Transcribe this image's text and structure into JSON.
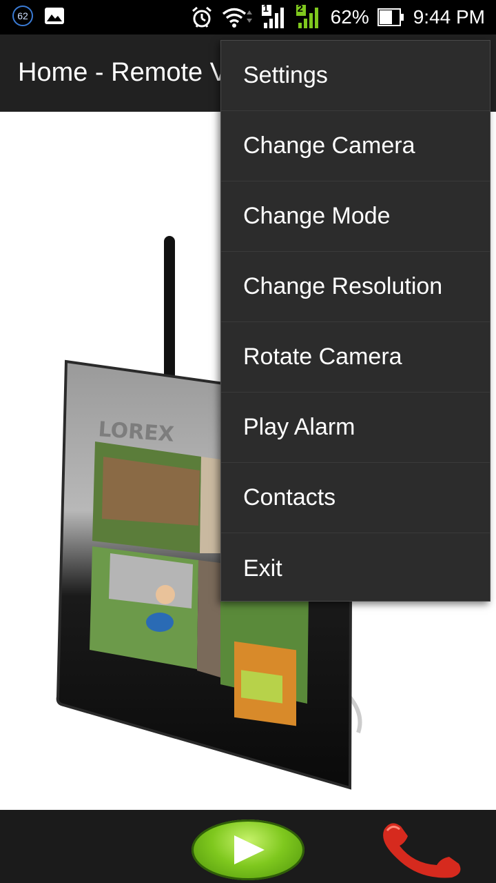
{
  "status_bar": {
    "notification_count": "62",
    "battery_percent": "62%",
    "time": "9:44 PM",
    "sim1_label": "1",
    "sim2_label": "2",
    "icons": [
      "notification-count-badge",
      "image-icon",
      "alarm-icon",
      "wifi-icon",
      "signal-sim1-icon",
      "signal-sim2-icon",
      "battery-icon"
    ]
  },
  "app_bar": {
    "title": "Home - Remote V"
  },
  "product_image": {
    "brand_text": "LOREX"
  },
  "overflow_menu": {
    "items": [
      {
        "label": "Settings"
      },
      {
        "label": "Change Camera"
      },
      {
        "label": "Change Mode"
      },
      {
        "label": "Change Resolution"
      },
      {
        "label": "Rotate Camera"
      },
      {
        "label": "Play Alarm"
      },
      {
        "label": "Contacts"
      },
      {
        "label": "Exit"
      }
    ]
  },
  "bottom_bar": {
    "icons": [
      "play-icon",
      "hang-up-phone-icon"
    ]
  },
  "colors": {
    "status_bar_bg": "#000000",
    "app_bar_bg": "#212121",
    "menu_bg": "#2c2c2c",
    "play_green": "#7fc81e",
    "phone_red": "#d62a1e",
    "signal_green": "#7fc81e"
  }
}
